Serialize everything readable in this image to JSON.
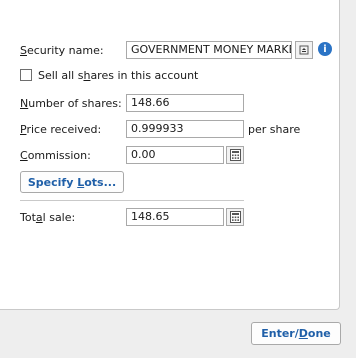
{
  "form": {
    "security_name_label": "Security name:",
    "security_name_value": "GOVERNMENT MONEY MARKET",
    "sell_all_label": "Sell all shares in this account",
    "sell_all_checked": false,
    "shares_label": "Number of shares:",
    "shares_value": "148.66",
    "price_label": "Price received:",
    "price_value": "0.999933",
    "per_share": "per share",
    "commission_label": "Commission:",
    "commission_value": "0.00",
    "specify_lots": "Specify Lots...",
    "total_label": "Total sale:",
    "total_value": "148.65"
  },
  "footer": {
    "enter_done": "Enter/Done"
  },
  "icons": {
    "info_color": "#2a73c5",
    "accent": "#1f5fa8"
  }
}
